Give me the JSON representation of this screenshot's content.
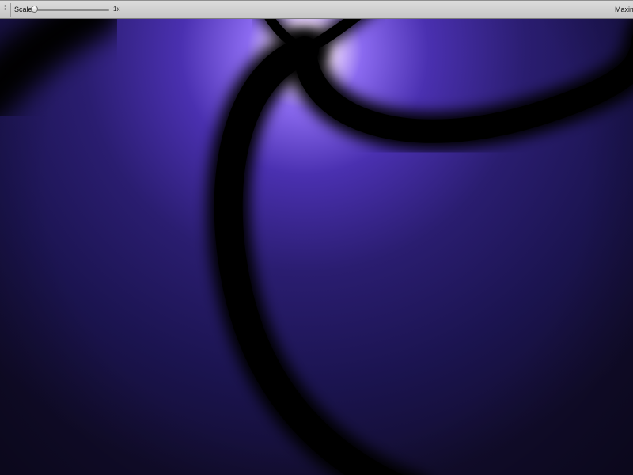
{
  "toolbar": {
    "scale_label": "Scale",
    "scale_value": "1x",
    "maximize_label": "Maxim"
  },
  "colors": {
    "toolbar_bg": "#d4d4d4",
    "glow_core": "#ffffff",
    "glow_violet": "#8b6af0",
    "background_deep": "#140f32",
    "arm_dark": "#000000"
  }
}
